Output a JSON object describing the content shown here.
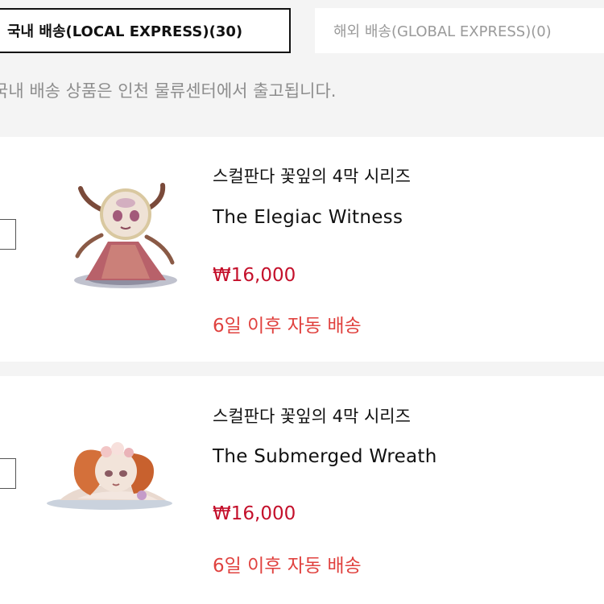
{
  "tabs": {
    "local": "국내 배송(LOCAL EXPRESS)(30)",
    "global": "해외 배송(GLOBAL EXPRESS)(0)"
  },
  "notice": "국내 배송 상품은 인천 물류센터에서 출고됩니다.",
  "products": [
    {
      "series": "스컬판다 꽃잎의 4막 시리즈",
      "name": "The Elegiac Witness",
      "price": "₩16,000",
      "shipping": "6일 이후 자동 배송",
      "image": "figure-elegiac-witness"
    },
    {
      "series": "스컬판다 꽃잎의 4막 시리즈",
      "name": "The Submerged Wreath",
      "price": "₩16,000",
      "shipping": "6일 이후 자동 배송",
      "image": "figure-submerged-wreath"
    }
  ],
  "colors": {
    "accent_price": "#c4102b",
    "accent_shipping": "#e0423f",
    "background": "#f4f4f4"
  }
}
